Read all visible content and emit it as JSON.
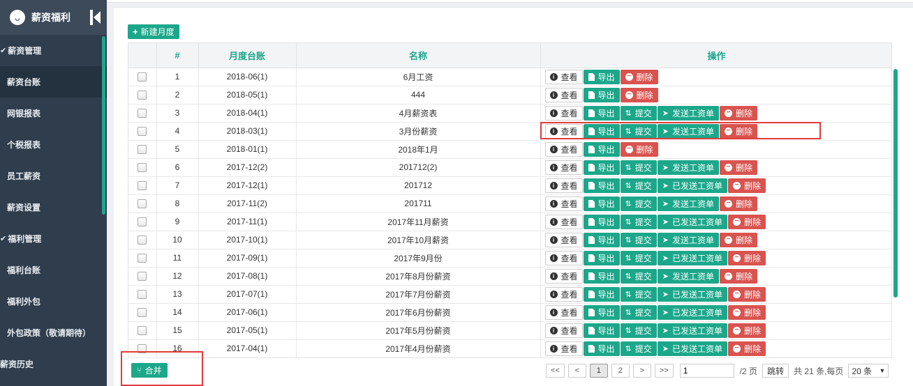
{
  "sidebar": {
    "title": "薪资福利",
    "logo_icon": "owl-icon",
    "collapse_icon": "collapse-left-icon",
    "items": [
      {
        "label": "薪资管理",
        "type": "group",
        "icon": "check-icon"
      },
      {
        "label": "薪资台账",
        "type": "item",
        "active": true
      },
      {
        "label": "网银报表",
        "type": "item"
      },
      {
        "label": "个税报表",
        "type": "item"
      },
      {
        "label": "员工薪资",
        "type": "item"
      },
      {
        "label": "薪资设置",
        "type": "item"
      },
      {
        "label": "福利管理",
        "type": "group",
        "icon": "check-icon"
      },
      {
        "label": "福利台账",
        "type": "item"
      },
      {
        "label": "福利外包",
        "type": "item"
      },
      {
        "label": "外包政策（敬请期待）",
        "type": "item"
      },
      {
        "label": "薪资历史",
        "type": "edge"
      }
    ]
  },
  "toolbar": {
    "new_label": "新建月度",
    "merge_label": "合并"
  },
  "table": {
    "headers": [
      "",
      "#",
      "月度台账",
      "名称",
      "操作"
    ],
    "rows": [
      {
        "no": "1",
        "ledger": "2018-06(1)",
        "name": "6月工资",
        "ops": [
          "view",
          "export",
          "delete"
        ]
      },
      {
        "no": "2",
        "ledger": "2018-05(1)",
        "name": "444",
        "ops": [
          "view",
          "export",
          "delete"
        ]
      },
      {
        "no": "3",
        "ledger": "2018-04(1)",
        "name": "4月薪资表",
        "ops": [
          "view",
          "export",
          "submit",
          "send",
          "delete"
        ]
      },
      {
        "no": "4",
        "ledger": "2018-03(1)",
        "name": "3月份薪资",
        "ops": [
          "view",
          "export",
          "submit",
          "send",
          "delete"
        ]
      },
      {
        "no": "5",
        "ledger": "2018-01(1)",
        "name": "2018年1月",
        "ops": [
          "view",
          "export",
          "delete"
        ]
      },
      {
        "no": "6",
        "ledger": "2017-12(2)",
        "name": "201712(2)",
        "ops": [
          "view",
          "export",
          "submit",
          "send",
          "delete"
        ]
      },
      {
        "no": "7",
        "ledger": "2017-12(1)",
        "name": "201712",
        "ops": [
          "view",
          "export",
          "submit",
          "sent",
          "delete"
        ]
      },
      {
        "no": "8",
        "ledger": "2017-11(2)",
        "name": "201711",
        "ops": [
          "view",
          "export",
          "submit",
          "send",
          "delete"
        ]
      },
      {
        "no": "9",
        "ledger": "2017-11(1)",
        "name": "2017年11月薪资",
        "ops": [
          "view",
          "export",
          "submit",
          "sent",
          "delete"
        ]
      },
      {
        "no": "10",
        "ledger": "2017-10(1)",
        "name": "2017年10月薪资",
        "ops": [
          "view",
          "export",
          "submit",
          "send",
          "delete"
        ]
      },
      {
        "no": "11",
        "ledger": "2017-09(1)",
        "name": "2017年9月份",
        "ops": [
          "view",
          "export",
          "submit",
          "sent",
          "delete"
        ]
      },
      {
        "no": "12",
        "ledger": "2017-08(1)",
        "name": "2017年8月份薪资",
        "ops": [
          "view",
          "export",
          "submit",
          "send",
          "delete"
        ]
      },
      {
        "no": "13",
        "ledger": "2017-07(1)",
        "name": "2017年7月份薪资",
        "ops": [
          "view",
          "export",
          "submit",
          "sent",
          "delete"
        ]
      },
      {
        "no": "14",
        "ledger": "2017-06(1)",
        "name": "2017年6月份薪资",
        "ops": [
          "view",
          "export",
          "submit",
          "sent",
          "delete"
        ]
      },
      {
        "no": "15",
        "ledger": "2017-05(1)",
        "name": "2017年5月份薪资",
        "ops": [
          "view",
          "export",
          "submit",
          "sent",
          "delete"
        ]
      },
      {
        "no": "16",
        "ledger": "2017-04(1)",
        "name": "2017年4月份薪资",
        "ops": [
          "view",
          "export",
          "submit",
          "sent",
          "delete"
        ]
      }
    ]
  },
  "actions": {
    "view": {
      "label": "查看",
      "icon": "info-icon",
      "style": "default"
    },
    "export": {
      "label": "导出",
      "icon": "file-export-icon",
      "style": "green"
    },
    "submit": {
      "label": "提交",
      "icon": "git-pull-icon",
      "style": "green"
    },
    "send": {
      "label": "发送工资单",
      "icon": "paper-plane-icon",
      "style": "green"
    },
    "sent": {
      "label": "已发送工资单",
      "icon": "paper-plane-icon",
      "style": "green"
    },
    "delete": {
      "label": "删除",
      "icon": "minus-circle-icon",
      "style": "red"
    }
  },
  "pagination": {
    "first": "<<",
    "prev": "<",
    "pages": [
      "1",
      "2"
    ],
    "current": "1",
    "next": ">",
    "last": ">>",
    "goto_value": "1",
    "total_pages_text": "/2 页",
    "jump_label": "跳转",
    "total_text": "共 21 条,每页",
    "page_size": "20 条"
  },
  "colors": {
    "accent": "#1ca78a",
    "danger": "#d9534f",
    "sidebar_bg": "#2f3d4c",
    "highlight": "#e23a3a"
  }
}
